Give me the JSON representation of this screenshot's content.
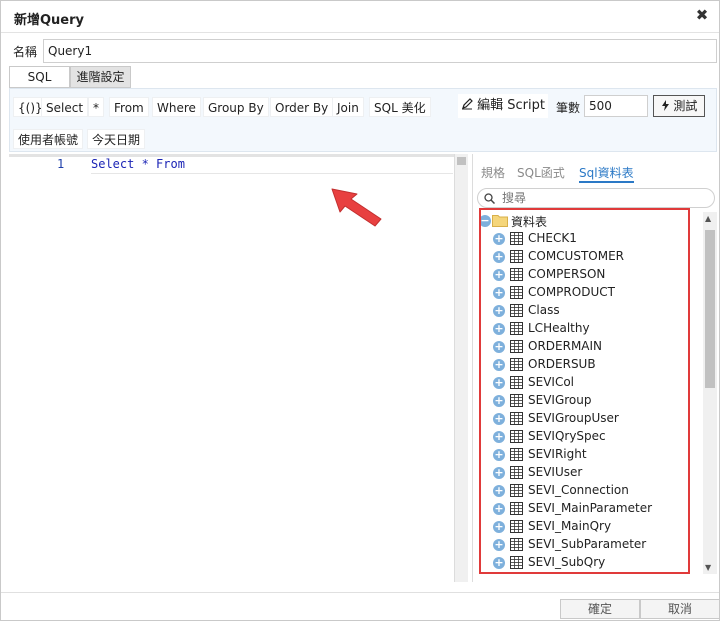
{
  "dialog": {
    "title": "新增Query",
    "close_glyph": "✖"
  },
  "name_field": {
    "label": "名稱",
    "value": "Query1"
  },
  "tabs": [
    {
      "label": "SQL"
    },
    {
      "label": "進階設定"
    }
  ],
  "toolbar": {
    "buttons": [
      "{()}",
      "Select",
      "*",
      "From",
      "Where",
      "Group By",
      "Order By",
      "Join",
      "SQL 美化"
    ],
    "buttons2": [
      "使用者帳號",
      "今天日期"
    ],
    "edit_script_label": "編輯 Script",
    "count_label": "筆數",
    "count_value": "500",
    "test_label": "測試"
  },
  "editor": {
    "line_number": "1",
    "code": "Select * From"
  },
  "side_panel": {
    "tabs": [
      "規格",
      "SQL函式",
      "Sql資料表"
    ],
    "search_placeholder": "搜尋",
    "tree_root": "資料表",
    "tables": [
      "CHECK1",
      "COMCUSTOMER",
      "COMPERSON",
      "COMPRODUCT",
      "Class",
      "LCHealthy",
      "ORDERMAIN",
      "ORDERSUB",
      "SEVICol",
      "SEVIGroup",
      "SEVIGroupUser",
      "SEVIQrySpec",
      "SEVIRight",
      "SEVIUser",
      "SEVI_Connection",
      "SEVI_MainParameter",
      "SEVI_MainQry",
      "SEVI_SubParameter",
      "SEVI_SubQry"
    ]
  },
  "footer": {
    "ok_label": "確定",
    "cancel_label": "取消"
  },
  "colors": {
    "accent": "#2b79c6",
    "highlight": "#e03a3a",
    "keyword": "#1b24b5",
    "toolbar_bg": "#f3f8fd"
  },
  "icons": {
    "folder": "folder-icon",
    "table": "table-icon",
    "expand": "plus-circle-icon",
    "search": "search-icon"
  }
}
